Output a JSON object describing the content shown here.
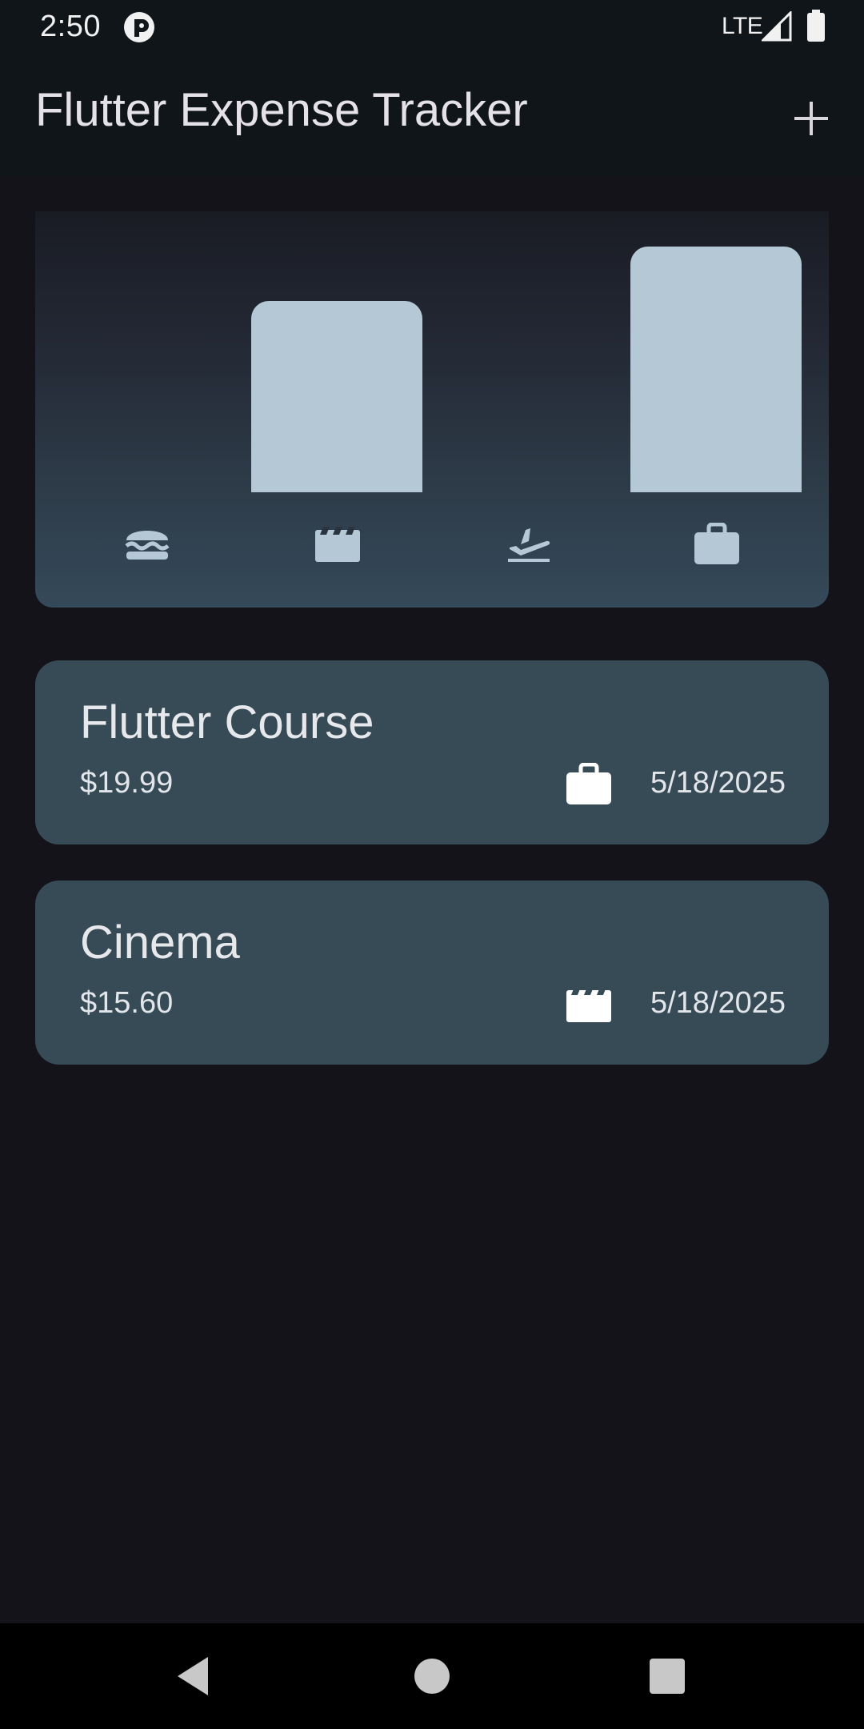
{
  "status_bar": {
    "time": "2:50",
    "network": "LTE",
    "icons": [
      "app-notification-icon",
      "signal-icon",
      "battery-icon"
    ]
  },
  "app_bar": {
    "title": "Flutter Expense Tracker",
    "add_icon": "plus-icon"
  },
  "chart": {
    "categories": [
      "food",
      "leisure",
      "travel",
      "work"
    ],
    "category_icons": [
      "burger-icon",
      "movie-icon",
      "flight-takeoff-icon",
      "work-icon"
    ],
    "relative_values": [
      0,
      0.78,
      0,
      1.0
    ],
    "bar_color": "#b4c9d5"
  },
  "expenses": [
    {
      "title": "Flutter Course",
      "amount": "$19.99",
      "category_icon": "work-icon",
      "date": "5/18/2025"
    },
    {
      "title": "Cinema",
      "amount": "$15.60",
      "category_icon": "movie-icon",
      "date": "5/18/2025"
    }
  ],
  "nav_bar": {
    "icons": [
      "back-icon",
      "home-icon",
      "recents-icon"
    ]
  },
  "colors": {
    "background": "#15131a",
    "app_bar": "#101519",
    "card": "#374b56",
    "accent": "#b4c9d5"
  }
}
